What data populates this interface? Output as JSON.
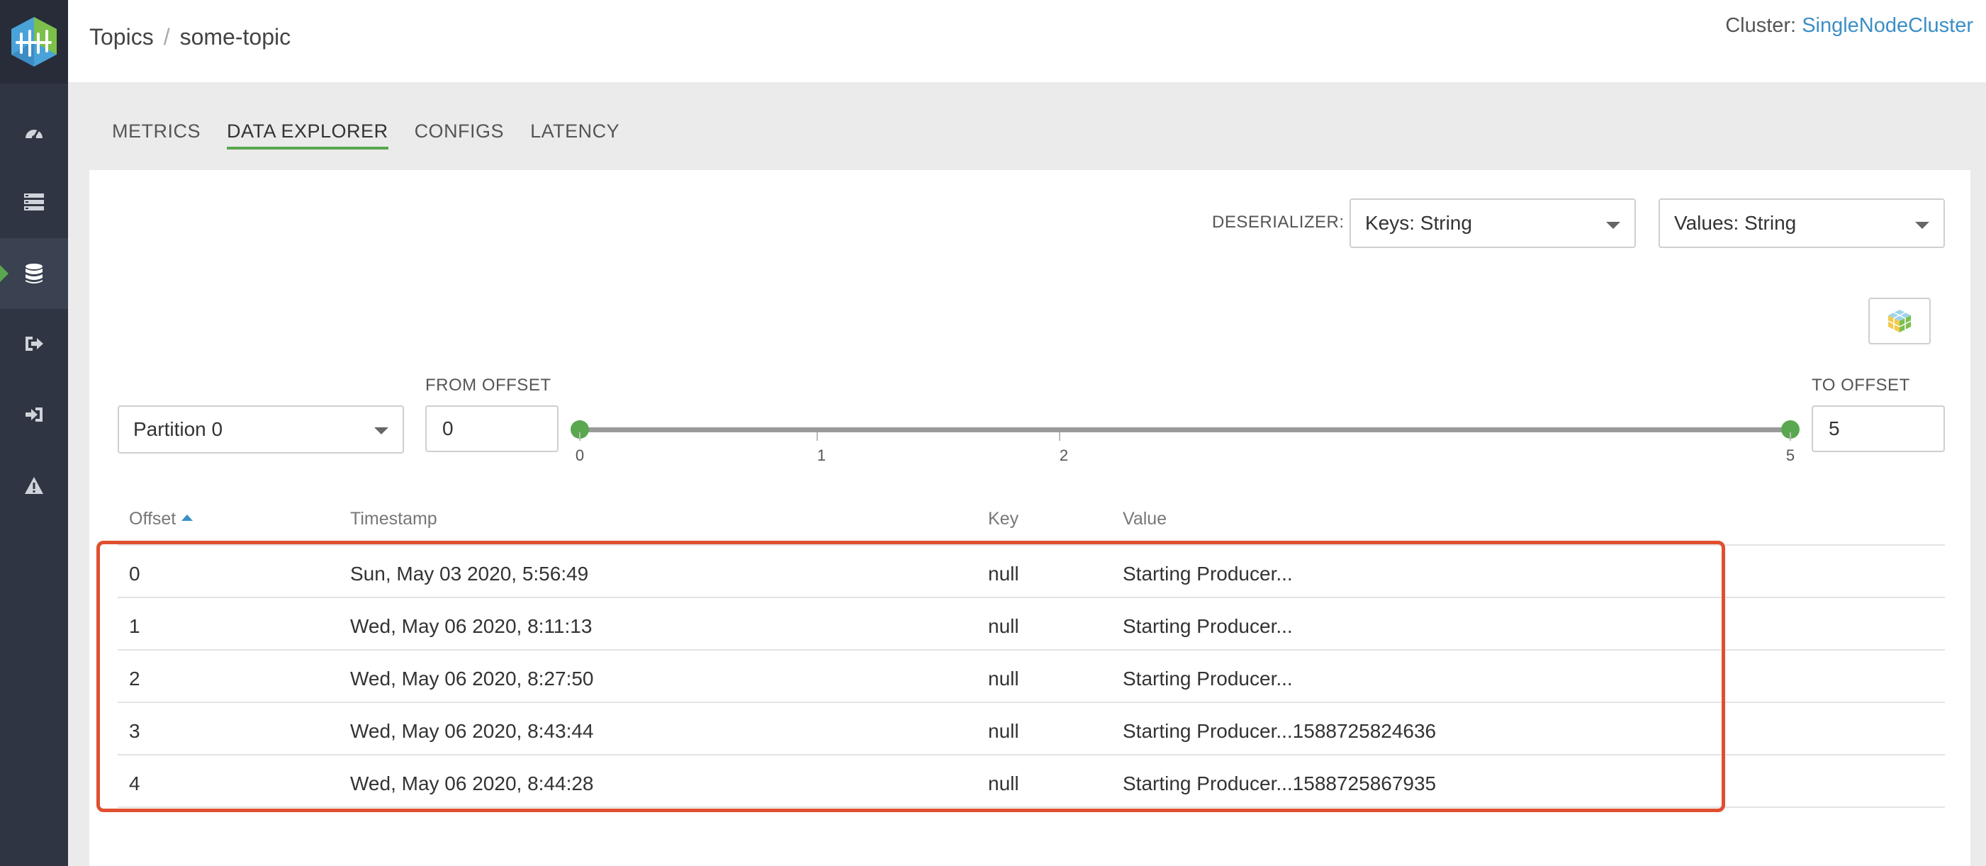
{
  "sidebar": {
    "logo": "kafka-logo",
    "items": [
      {
        "icon": "dashboard-icon"
      },
      {
        "icon": "brokers-list-icon"
      },
      {
        "icon": "database-icon",
        "active": true
      },
      {
        "icon": "producer-icon"
      },
      {
        "icon": "consumer-icon"
      },
      {
        "icon": "alert-icon"
      }
    ]
  },
  "header": {
    "breadcrumb": [
      "Topics",
      "some-topic"
    ],
    "breadcrumb_sep": "/",
    "cluster_label": "Cluster:",
    "cluster_name": "SingleNodeCluster"
  },
  "tabs": [
    {
      "label": "METRICS",
      "active": false
    },
    {
      "label": "DATA EXPLORER",
      "active": true
    },
    {
      "label": "CONFIGS",
      "active": false
    },
    {
      "label": "LATENCY",
      "active": false
    }
  ],
  "deserializer": {
    "label": "DESERIALIZER:",
    "keys_value": "Keys: String",
    "values_value": "Values: String"
  },
  "partition": {
    "value": "Partition 0"
  },
  "from_offset": {
    "label": "FROM OFFSET",
    "value": "0"
  },
  "to_offset": {
    "label": "TO OFFSET",
    "value": "5"
  },
  "slider": {
    "min": 0,
    "max": 5,
    "range": [
      0,
      5
    ],
    "tick_labels": [
      "0",
      "1",
      "2",
      "5"
    ]
  },
  "table": {
    "columns": [
      "Offset",
      "Timestamp",
      "Key",
      "Value"
    ],
    "sort_column": "Offset",
    "rows": [
      {
        "offset": "0",
        "timestamp": "Sun, May 03 2020, 5:56:49",
        "key": "null",
        "value": "Starting Producer..."
      },
      {
        "offset": "1",
        "timestamp": "Wed, May 06 2020, 8:11:13",
        "key": "null",
        "value": "Starting Producer..."
      },
      {
        "offset": "2",
        "timestamp": "Wed, May 06 2020, 8:27:50",
        "key": "null",
        "value": "Starting Producer..."
      },
      {
        "offset": "3",
        "timestamp": "Wed, May 06 2020, 8:43:44",
        "key": "null",
        "value": "Starting Producer...1588725824636"
      },
      {
        "offset": "4",
        "timestamp": "Wed, May 06 2020, 8:44:28",
        "key": "null",
        "value": "Starting Producer...1588725867935"
      }
    ]
  },
  "colors": {
    "accent": "#59a84f",
    "link": "#3b8fc7",
    "highlight": "#e0502f",
    "sidebar": "#2f3542"
  }
}
